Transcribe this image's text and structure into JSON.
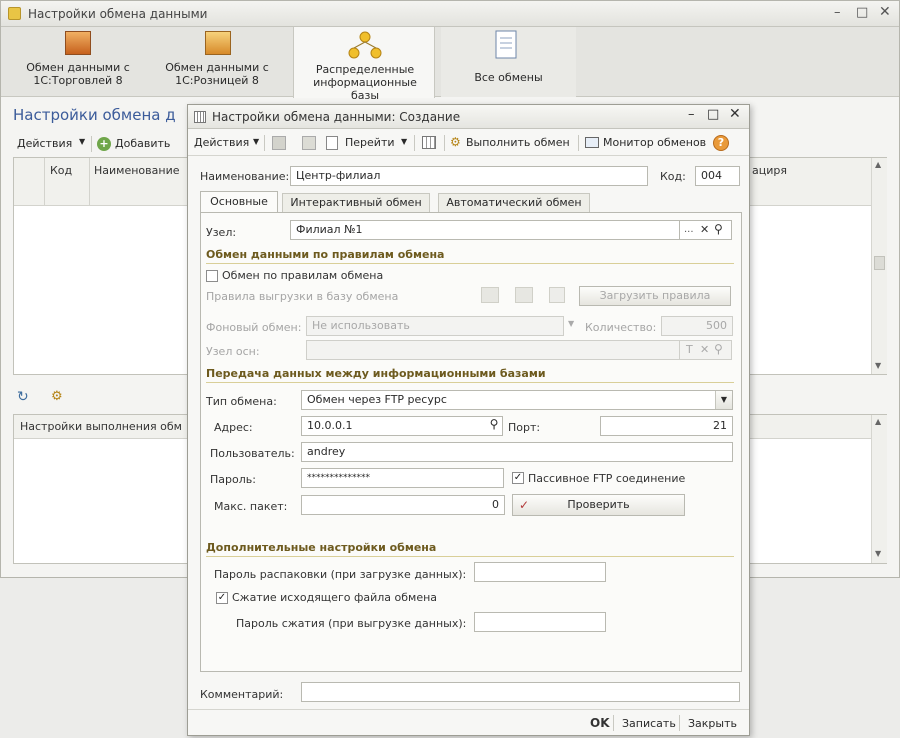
{
  "main_window": {
    "title": "Настройки обмена данными",
    "tabs": [
      {
        "label": "Обмен данными с 1С:Торговлей 8"
      },
      {
        "label": "Обмен данными с 1С:Розницей 8"
      },
      {
        "label": "Распределенные информационные базы"
      },
      {
        "label": "Все обмены"
      }
    ],
    "section_title": "Настройки обмена д",
    "toolbar": {
      "actions": "Действия",
      "add": "Добавить"
    },
    "grid": {
      "col_code": "Код",
      "col_name": "Наименование",
      "col_right": "ациря"
    },
    "lower_grid_header": "Настройки выполнения обм"
  },
  "dialog": {
    "title": "Настройки обмена данными: Создание",
    "toolbar": {
      "actions": "Действия",
      "goto": "Перейти",
      "run_exchange": "Выполнить обмен",
      "monitor": "Монитор обменов"
    },
    "name_label": "Наименование:",
    "name_value": "Центр-филиал",
    "code_label": "Код:",
    "code_value": "004",
    "tabs": [
      {
        "label": "Основные"
      },
      {
        "label": "Интерактивный обмен"
      },
      {
        "label": "Автоматический обмен"
      }
    ],
    "node_label": "Узел:",
    "node_value": "Филиал №1",
    "section_rules": "Обмен данными по правилам обмена",
    "by_rules_label": "Обмен по правилам обмена",
    "by_rules_checked": false,
    "upload_rules_label": "Правила выгрузки в базу обмена",
    "load_rules_button": "Загрузить правила",
    "background_label": "Фоновый обмен:",
    "background_value": "Не использовать",
    "count_label": "Количество:",
    "count_value": "500",
    "node_base_label": "Узел осн:",
    "section_transfer": "Передача данных между информационными базами",
    "type_label": "Тип обмена:",
    "type_value": "Обмен через FTP ресурс",
    "address_label": "Адрес:",
    "address_value": "10.0.0.1",
    "port_label": "Порт:",
    "port_value": "21",
    "user_label": "Пользователь:",
    "user_value": "andrey",
    "password_label": "Пароль:",
    "password_value": "**************",
    "passive_label": "Пассивное FTP соединение",
    "passive_checked": true,
    "max_packet_label": "Макс. пакет:",
    "max_packet_value": "0",
    "check_button": "Проверить",
    "section_additional": "Дополнительные настройки обмена",
    "unpack_password_label": "Пароль распаковки (при загрузке данных):",
    "compress_label": "Сжатие исходящего файла обмена",
    "compress_checked": true,
    "compress_password_label": "Пароль сжатия (при выгрузке данных):",
    "comment_label": "Комментарий:",
    "ok": "OK",
    "write": "Записать",
    "close": "Закрыть"
  }
}
